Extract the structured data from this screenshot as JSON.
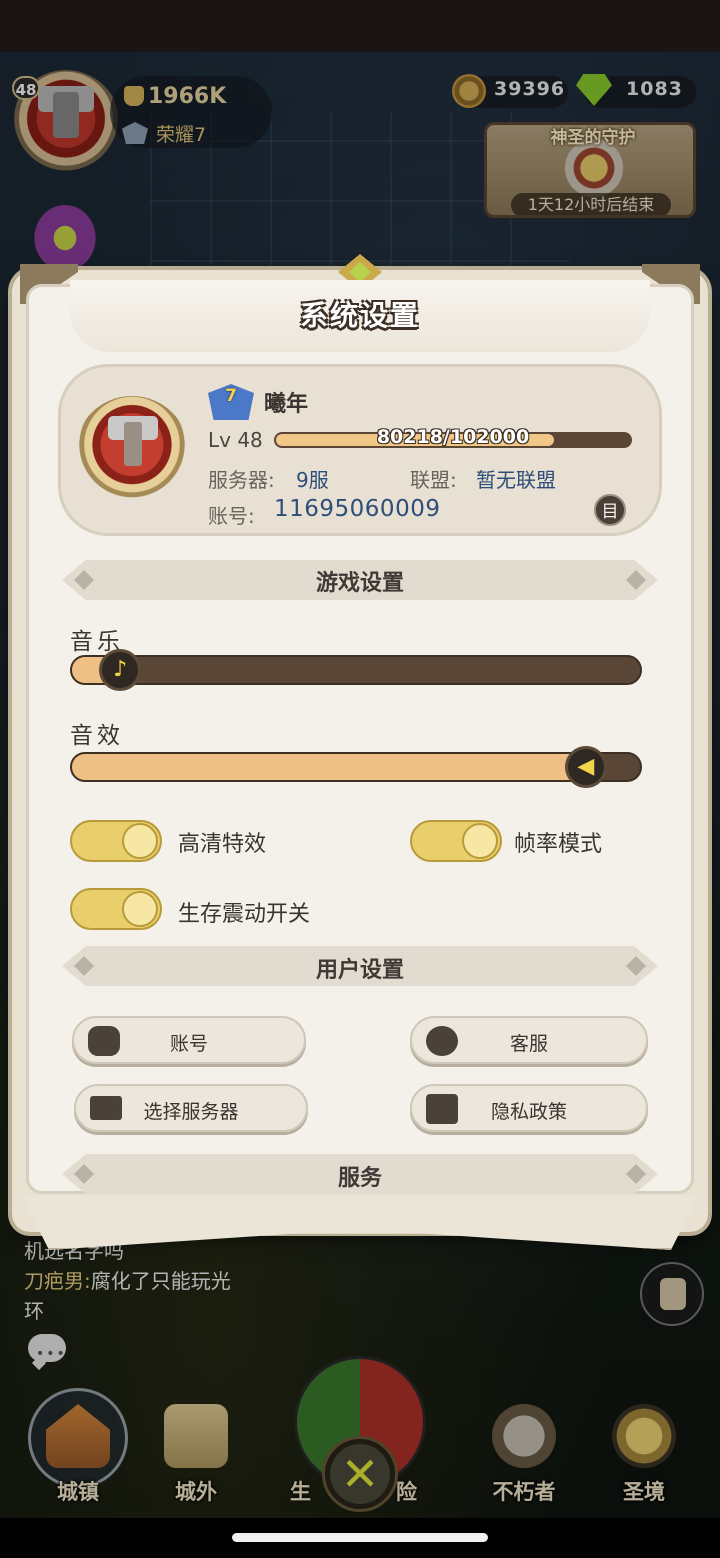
{
  "hud": {
    "level": "48",
    "power": "1966K",
    "rank_label": "荣耀7",
    "gold": "39396",
    "gems": "1083",
    "event_title": "神圣的守护",
    "event_timer": "1天12小时后结束"
  },
  "dialog": {
    "title": "系统设置",
    "profile": {
      "vip_level": "7",
      "name": "曦年",
      "level_label": "Lv 48",
      "xp_current": 80218,
      "xp_max": 102000,
      "xp_text": "80218/102000",
      "server_key": "服务器:",
      "server_val": "9服",
      "alliance_key": "联盟:",
      "alliance_val": "暂无联盟",
      "account_key": "账号:",
      "account_val": "11695060009",
      "copy_glyph": "目"
    },
    "game_settings": {
      "header": "游戏设置",
      "music_label": "音乐",
      "music_level": 0.09,
      "sfx_label": "音效",
      "sfx_level": 0.91,
      "music_glyph": "♪",
      "sfx_glyph": "◀",
      "toggles": [
        {
          "label": "高清特效",
          "on": true
        },
        {
          "label": "帧率模式",
          "on": true
        },
        {
          "label": "生存震动开关",
          "on": true
        }
      ]
    },
    "user_settings": {
      "header": "用户设置",
      "buttons": [
        {
          "label": "账号",
          "icon": "gamepad-icon"
        },
        {
          "label": "客服",
          "icon": "support-icon"
        },
        {
          "label": "选择服务器",
          "icon": "laptop-icon"
        },
        {
          "label": "隐私政策",
          "icon": "privacy-icon"
        }
      ]
    },
    "service": {
      "header": "服务"
    }
  },
  "chat": {
    "line1": "机选名字吗",
    "line2_name": "刀疤男:",
    "line2_msg": "腐化了只能玩光",
    "line3": "环",
    "bubble_dots": "•••"
  },
  "nav": {
    "items": [
      {
        "label": "城镇"
      },
      {
        "label": "城外"
      },
      {
        "label": "生"
      },
      {
        "label": "险"
      },
      {
        "label": "不朽者"
      },
      {
        "label": "圣境"
      }
    ],
    "close_glyph": "✕"
  }
}
